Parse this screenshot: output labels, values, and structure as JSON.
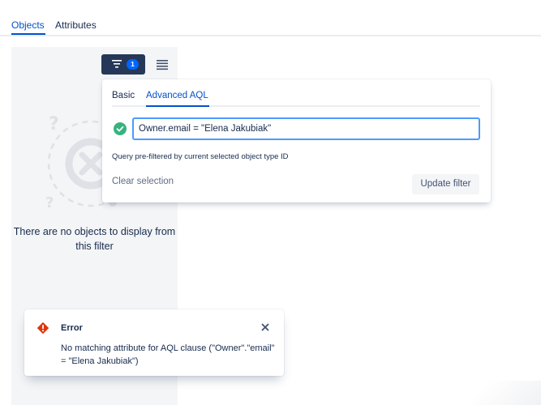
{
  "tabs": [
    {
      "label": "Objects",
      "active": true
    },
    {
      "label": "Attributes",
      "active": false
    }
  ],
  "toolbar": {
    "filter_count": "1",
    "filter_icon": "filter-icon",
    "list_icon": "list-view-icon"
  },
  "empty_state": {
    "message": "There are no objects to display from this filter",
    "illustration": "no-results-illustration"
  },
  "filter_popup": {
    "tabs": [
      {
        "label": "Basic",
        "active": false
      },
      {
        "label": "Advanced AQL",
        "active": true
      }
    ],
    "query_value": "Owner.email = \"Elena Jakubiak\"",
    "validation_icon": "check-circle-icon",
    "helper_text": "Query pre-filtered by current selected object type ID",
    "clear_label": "Clear selection",
    "update_label": "Update filter"
  },
  "error_flag": {
    "icon": "error-icon",
    "title": "Error",
    "description": "No matching attribute for AQL clause (\"Owner\".\"email\" = \"Elena Jakubiak\")",
    "close_icon": "close-icon"
  },
  "colors": {
    "accent": "#0052cc",
    "dark_button": "#253858",
    "badge": "#0065ff",
    "success": "#36b37e",
    "error": "#de350b",
    "panel_bg": "#f4f5f7"
  }
}
